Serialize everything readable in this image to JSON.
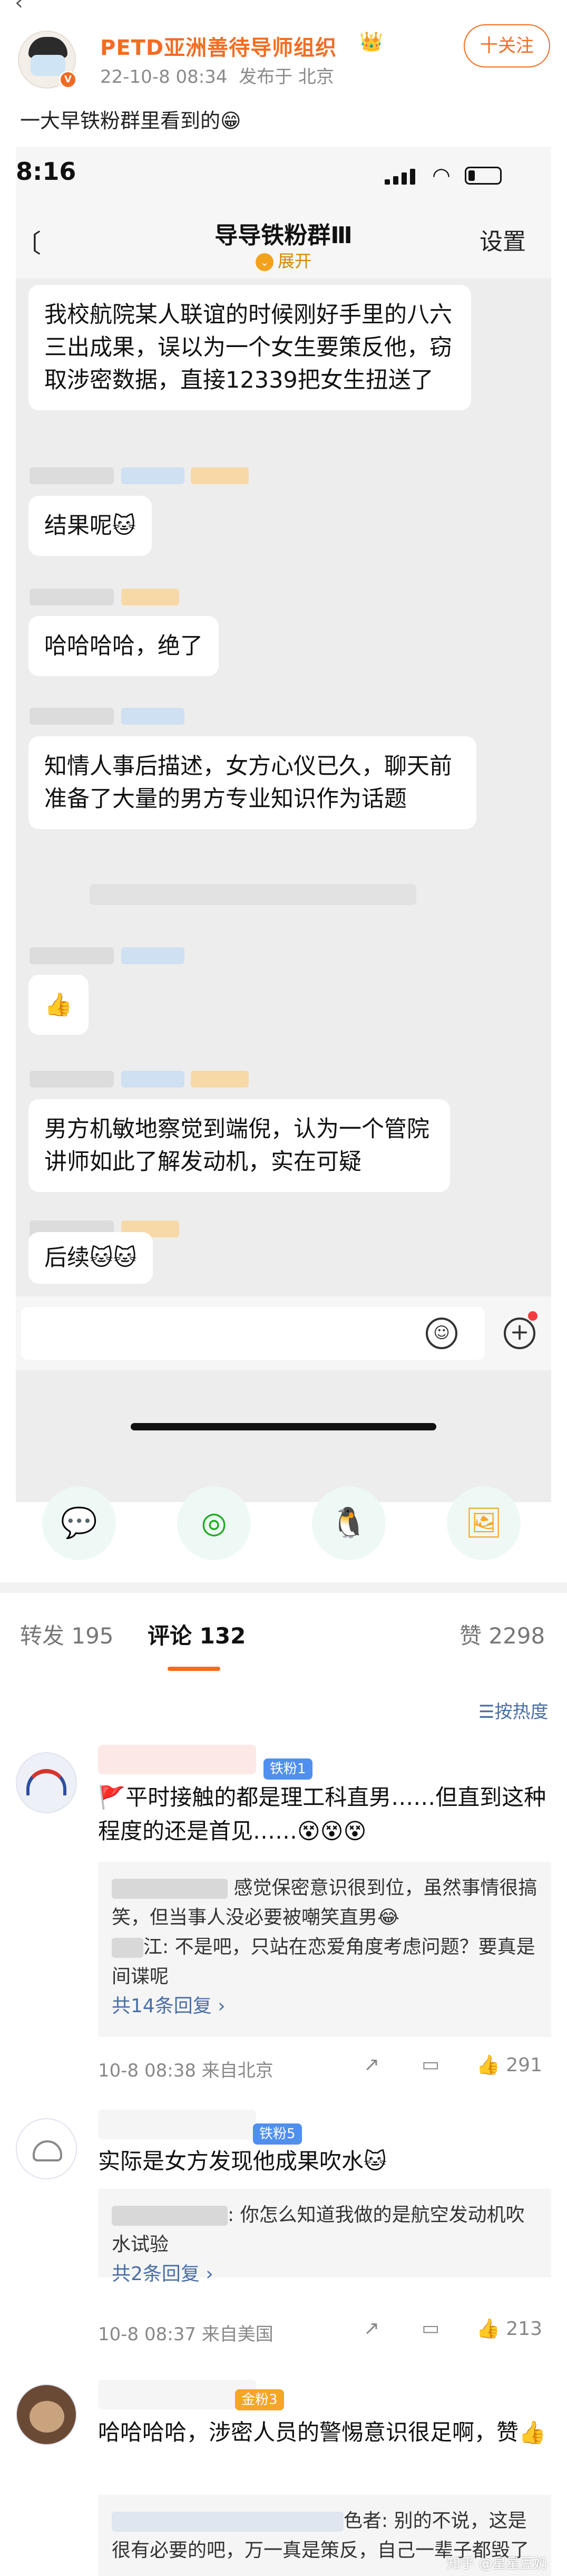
{
  "post": {
    "author": "PETD亚洲善待导师组织",
    "crown": "👑",
    "verified": "V",
    "date": "22-10-8 08:34",
    "source": "发布于 北京",
    "follow_label": "十关注",
    "text": "一大早铁粉群里看到的😁"
  },
  "phone": {
    "time": "8:16",
    "group_title": "导导铁粉群Ⅲ",
    "expand_label": "展开",
    "settings_label": "设置",
    "messages": [
      "我校航院某人联谊的时候刚好手里的八六三出成果，误以为一个女生要策反他，窃取涉密数据，直接12339把女生扭送了",
      "结果呢🐱",
      "哈哈哈哈，绝了",
      "知情人事后描述，女方心仪已久，聊天前准备了大量的男方专业知识作为话题",
      "👍",
      "男方机敏地察觉到端倪，认为一个管院讲师如此了解发动机，实在可疑",
      "后续🐱🐱"
    ]
  },
  "share": {
    "icons": [
      "wechat-icon",
      "moments-icon",
      "qq-icon",
      "save-image-icon"
    ],
    "glyphs": [
      "💬",
      "◎",
      "🐧",
      "🖼"
    ]
  },
  "tabs": {
    "repost": "转发 195",
    "comments": "评论 132",
    "likes": "赞 2298",
    "sort": "☰按热度"
  },
  "comments": [
    {
      "fan_badge": "铁粉1",
      "text": "🚩平时接触的都是理工科直男……但直到这种程度的还是首见……😵😵😵",
      "replies": [
        "感觉保密意识很到位，虽然事情很搞笑，但当事人没必要被嘲笑直男😂",
        "江: 不是吧，只站在恋爱角度考虑问题？要真是间谍呢"
      ],
      "more": "共14条回复 ›",
      "meta": "10-8 08:38 来自北京",
      "likes": "291"
    },
    {
      "fan_badge": "铁粉5",
      "text": "实际是女方发现他成果吹水🐱",
      "replies": [
        ": 你怎么知道我做的是航空发动机吹水试验"
      ],
      "more": "共2条回复 ›",
      "meta": "10-8 08:37 来自美国",
      "likes": "213"
    },
    {
      "fan_badge": "金粉3",
      "text": "哈哈哈哈，涉密人员的警惕意识很足啊，赞👍",
      "replies": [
        "色者: 别的不说，这是很有必要的吧，万一真是策反，自己一辈子都毁了"
      ],
      "watermark": "知乎 @星星豆奶"
    }
  ]
}
